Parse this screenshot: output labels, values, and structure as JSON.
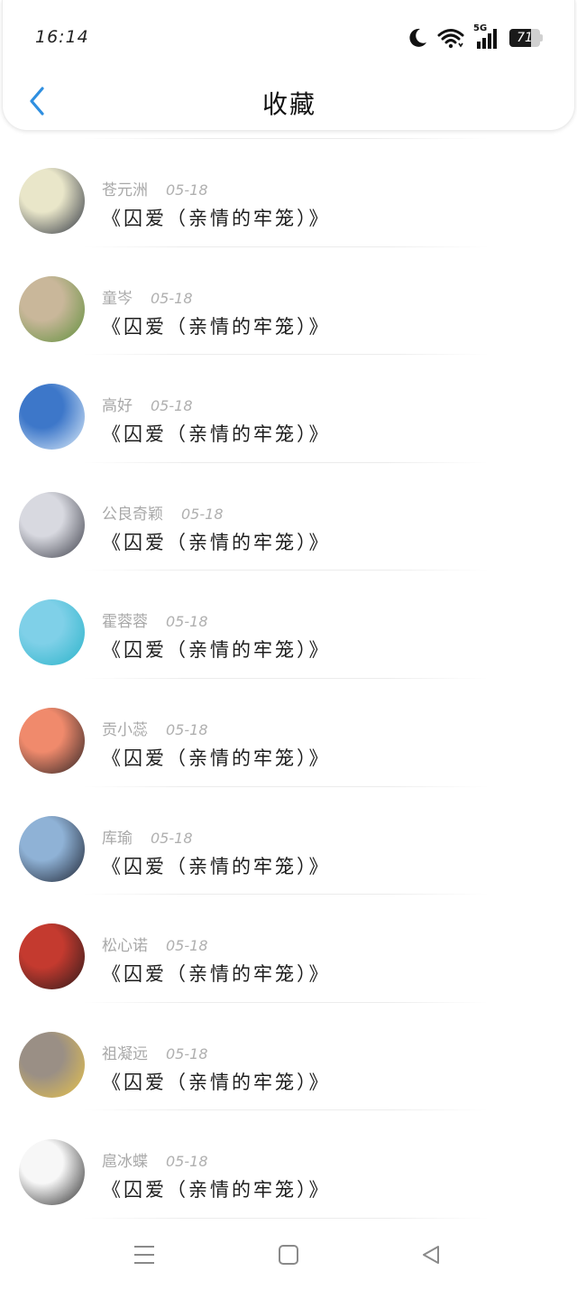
{
  "status_bar": {
    "time": "16:14",
    "network": "5G",
    "battery_level": "71",
    "battery_fraction": 0.71,
    "icons": [
      "moon-icon",
      "wifi-icon",
      "signal-icon",
      "battery-icon"
    ]
  },
  "header": {
    "title": "收藏",
    "back_icon": "chevron-left-icon",
    "accent_color": "#2f8fe0"
  },
  "favorites": [
    {
      "name": "苍元洲",
      "date": "05-18",
      "title": "《囚爱（亲情的牢笼）》",
      "avatar_colors": [
        "#e9e6c9",
        "#2d3340"
      ]
    },
    {
      "name": "童岑",
      "date": "05-18",
      "title": "《囚爱（亲情的牢笼）》",
      "avatar_colors": [
        "#c9b79a",
        "#5e8f3a"
      ]
    },
    {
      "name": "高好",
      "date": "05-18",
      "title": "《囚爱（亲情的牢笼）》",
      "avatar_colors": [
        "#3d77c9",
        "#dfeefa"
      ]
    },
    {
      "name": "公良奇颖",
      "date": "05-18",
      "title": "《囚爱（亲情的牢笼）》",
      "avatar_colors": [
        "#d8d9e0",
        "#3a3c47"
      ]
    },
    {
      "name": "霍蓉蓉",
      "date": "05-18",
      "title": "《囚爱（亲情的牢笼）》",
      "avatar_colors": [
        "#7fd0e8",
        "#29b3c9"
      ]
    },
    {
      "name": "贡小蕊",
      "date": "05-18",
      "title": "《囚爱（亲情的牢笼）》",
      "avatar_colors": [
        "#f08a6c",
        "#2b2324"
      ]
    },
    {
      "name": "库瑜",
      "date": "05-18",
      "title": "《囚爱（亲情的牢笼）》",
      "avatar_colors": [
        "#8fb2d6",
        "#1c2230"
      ]
    },
    {
      "name": "松心诺",
      "date": "05-18",
      "title": "《囚爱（亲情的牢笼）》",
      "avatar_colors": [
        "#c43a2f",
        "#2a1a1a"
      ]
    },
    {
      "name": "祖凝远",
      "date": "05-18",
      "title": "《囚爱（亲情的牢笼）》",
      "avatar_colors": [
        "#9a8f85",
        "#e8c34a"
      ]
    },
    {
      "name": "扈冰蝶",
      "date": "05-18",
      "title": "《囚爱（亲情的牢笼）》",
      "avatar_colors": [
        "#f7f7f7",
        "#2a2a2a"
      ]
    }
  ],
  "bottom_nav": {
    "items": [
      "menu-icon",
      "home-icon",
      "back-triangle-icon"
    ]
  }
}
